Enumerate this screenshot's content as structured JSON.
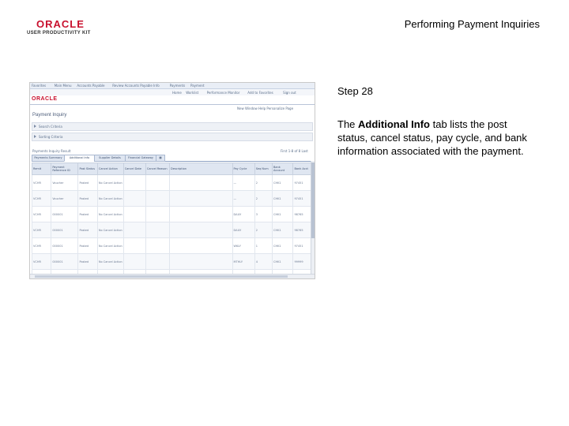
{
  "header": {
    "logo_word": "ORACLE",
    "logo_sub": "USER PRODUCTIVITY KIT",
    "title": "Performing Payment Inquiries",
    "brand_color": "#c8102e"
  },
  "step": {
    "label": "Step 28",
    "desc_prefix": "The ",
    "desc_bold": "Additional Info",
    "desc_suffix": " tab lists the post status, cancel status, pay cycle, and bank information associated with the payment."
  },
  "screenshot": {
    "nav_items": [
      "Favorites",
      "Main Menu",
      "Accounts Payable",
      "Review Accounts Payable Info",
      "Payments",
      "Payment"
    ],
    "subnav_items": [
      "Home",
      "Worklist",
      "Performance Monitor",
      "Add to Favorites",
      "Sign out"
    ],
    "oracle_mini": "ORACLE",
    "toolbar_right": "New Window  Help  Personalize Page",
    "page_title": "Payment Inquiry",
    "collapsibles": [
      "Search Criteria",
      "Sorting Criteria"
    ],
    "grid_title": "Payments Inquiry Result",
    "grid_nav": "First  1-8 of 8  Last",
    "tabs": [
      "Payments Summary",
      "Additional Info",
      "Supplier Details",
      "Financial Gateway"
    ],
    "columns": [
      "Remit",
      "Payment Reference ID",
      "Post Status",
      "Cancel Action",
      "Cancel Date",
      "Cancel Reason",
      "Description",
      "Pay Cycle",
      "Seq Num",
      "Bank Account",
      "Bank Acct"
    ],
    "rows": [
      [
        "VCHR",
        "Voucher",
        "Posted",
        "No Cancel Action",
        "",
        "",
        "",
        "—",
        "2",
        "CHK1",
        "97451"
      ],
      [
        "VCHR",
        "Voucher",
        "Posted",
        "No Cancel Action",
        "",
        "",
        "",
        "—",
        "2",
        "CHK1",
        "97451"
      ],
      [
        "VCHR",
        "000001",
        "Posted",
        "No Cancel Action",
        "",
        "",
        "",
        "DAILY",
        "3",
        "CHK1",
        "98765"
      ],
      [
        "VCHR",
        "000001",
        "Posted",
        "No Cancel Action",
        "",
        "",
        "",
        "DAILY",
        "2",
        "CHK1",
        "98765"
      ],
      [
        "VCHR",
        "000001",
        "Posted",
        "No Cancel Action",
        "",
        "",
        "",
        "WKLY",
        "1",
        "CHK1",
        "97451"
      ],
      [
        "VCHR",
        "000001",
        "Posted",
        "No Cancel Action",
        "",
        "",
        "",
        "MTHLY",
        "4",
        "CHK1",
        "99999"
      ],
      [
        "VCHR",
        "000001",
        "Posted",
        "No Cancel Action",
        "",
        "",
        "",
        "Daily",
        "2",
        "CHK1",
        "88888"
      ]
    ]
  }
}
